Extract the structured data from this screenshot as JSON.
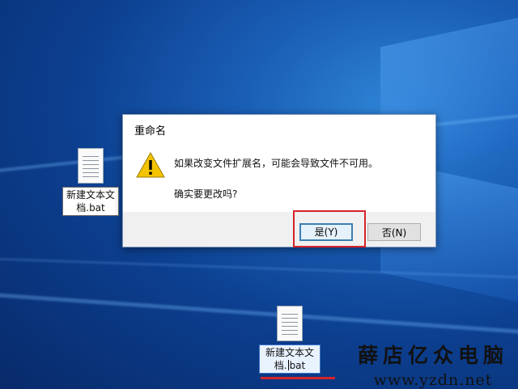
{
  "desktop": {
    "icons": [
      {
        "label": "新建文本文档.bat"
      },
      {
        "label_before_caret": "新建文本文档.",
        "label_after_caret": "bat"
      }
    ]
  },
  "dialog": {
    "title": "重命名",
    "message": "如果改变文件扩展名，可能会导致文件不可用。",
    "question": "确实要更改吗?",
    "yes_label": "是(Y)",
    "no_label": "否(N)",
    "icon": "warning-icon"
  },
  "watermark": {
    "brand": "薛店亿众电脑",
    "url": "www.yzdn.net"
  },
  "colors": {
    "highlight": "#d6232a",
    "desktop": "#0c3f8f",
    "warning": "#f5c400"
  }
}
